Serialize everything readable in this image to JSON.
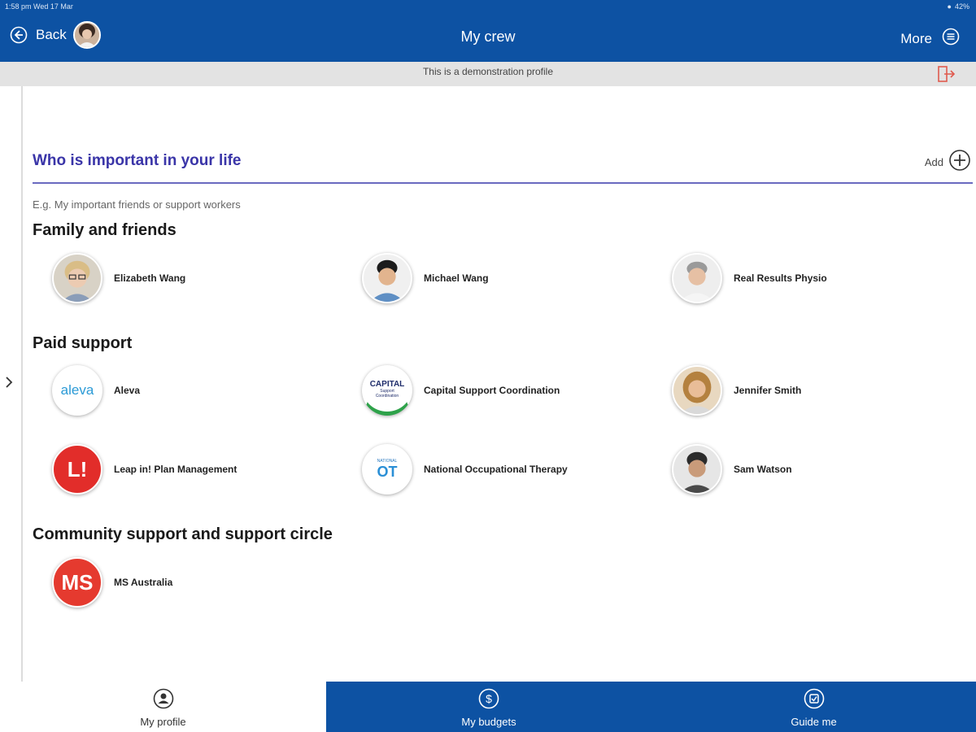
{
  "status_bar": {
    "time": "1:58 pm  Wed 17 Mar",
    "battery": "42%"
  },
  "nav": {
    "back_label": "Back",
    "title": "My crew",
    "more_label": "More"
  },
  "banner": {
    "text": "This is a demonstration profile"
  },
  "section": {
    "title": "Who is important in your life",
    "add_label": "Add",
    "hint": "E.g. My important friends or support workers"
  },
  "groups": [
    {
      "title": "Family and friends",
      "contacts": [
        {
          "name": "Elizabeth Wang"
        },
        {
          "name": "Michael Wang"
        },
        {
          "name": "Real Results Physio"
        }
      ]
    },
    {
      "title": "Paid support",
      "contacts": [
        {
          "name": "Aleva",
          "logo_text": "aleva"
        },
        {
          "name": "Capital Support Coordination",
          "logo_text": "CAPITAL",
          "logo_sub": "Support Coordination"
        },
        {
          "name": "Jennifer Smith"
        },
        {
          "name": "Leap in! Plan Management",
          "logo_text": "L!"
        },
        {
          "name": "National Occupational Therapy",
          "logo_text": "OT",
          "logo_sub": "NATIONAL"
        },
        {
          "name": "Sam Watson"
        }
      ]
    },
    {
      "title": "Community support and support circle",
      "contacts": [
        {
          "name": "MS Australia",
          "logo_text": "MS"
        }
      ]
    }
  ],
  "tabs": [
    {
      "label": "My profile",
      "icon": "person-icon"
    },
    {
      "label": "My budgets",
      "icon": "dollar-icon"
    },
    {
      "label": "Guide me",
      "icon": "guide-icon"
    }
  ],
  "colors": {
    "primary": "#0d52a3",
    "section_title": "#3a35a8",
    "divider": "#6a6ac0",
    "exit_icon": "#e05a4e"
  }
}
